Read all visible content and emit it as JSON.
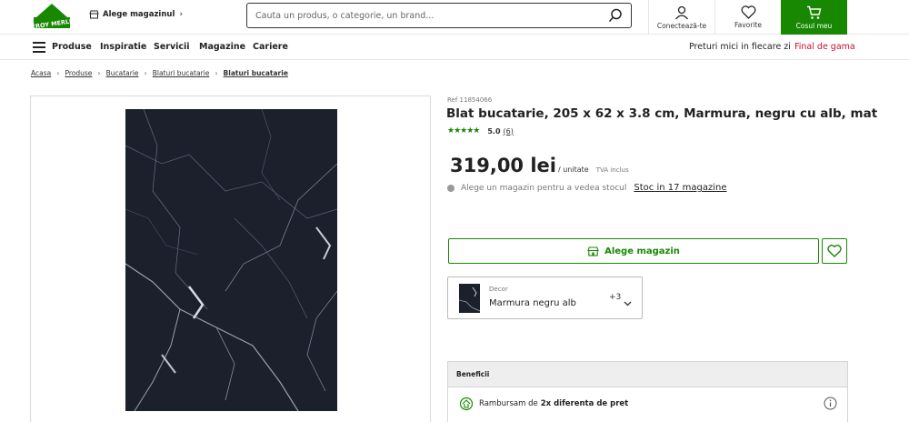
{
  "header": {
    "logo_alt": "LEROY MERLIN",
    "store_selector": "Alege magazinul",
    "search_placeholder": "Cauta un produs, o categorie, un brand...",
    "account_label": "Conectează-te",
    "favorites_label": "Favorite",
    "cart_label": "Cosul meu"
  },
  "nav": {
    "menu_label": "Produse",
    "items": [
      "Inspiratie",
      "Servicii",
      "Magazine",
      "Cariere"
    ],
    "right_links": [
      "Preturi mici in fiecare zi",
      "Final de gama"
    ]
  },
  "breadcrumb": [
    "Acasa",
    "Produse",
    "Bucatarie",
    "Blaturi bucatarie",
    "Blaturi bucatarie"
  ],
  "product": {
    "ref": "Ref 11854066",
    "title": "Blat bucatarie, 205 x 62 x 3.8 cm, Marmura, negru cu alb, mat",
    "rating_score": "5.0",
    "rating_count": "(6)",
    "rating_value": 5,
    "price": "319,00 lei",
    "price_unit": "/ unitate",
    "vat_note": "TVA inclus",
    "stock_text": "Alege un magazin pentru a vedea stocul",
    "stock_link": "Stoc in 17 magazine",
    "choose_store_button": "Alege magazin",
    "variant": {
      "label": "Decor",
      "value": "Marmura negru alb",
      "more": "+3"
    }
  },
  "benefits": {
    "title": "Beneficii",
    "row_prefix": "Rambursam de",
    "row_bold": "2x diferenta de pret"
  },
  "colors": {
    "brand_green": "#188803",
    "link_red": "#c8102e"
  }
}
